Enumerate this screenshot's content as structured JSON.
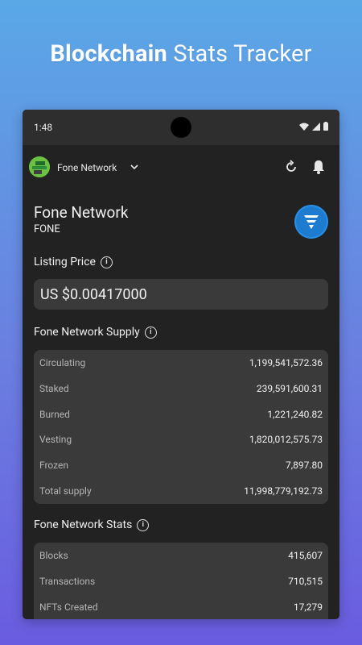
{
  "promo": {
    "title_bold": "Blockchain",
    "title_rest": "Stats Tracker"
  },
  "status_bar": {
    "time": "1:48"
  },
  "app_bar": {
    "network_selector": "Fone Network"
  },
  "coin": {
    "name": "Fone Network",
    "ticker": "FONE"
  },
  "listing_price": {
    "title": "Listing Price",
    "value": "US $0.00417000"
  },
  "supply": {
    "title": "Fone Network Supply",
    "rows": [
      {
        "label": "Circulating",
        "value": "1,199,541,572.36"
      },
      {
        "label": "Staked",
        "value": "239,591,600.31"
      },
      {
        "label": "Burned",
        "value": "1,221,240.82"
      },
      {
        "label": "Vesting",
        "value": "1,820,012,575.73"
      },
      {
        "label": "Frozen",
        "value": "7,897.80"
      },
      {
        "label": "Total supply",
        "value": "11,998,779,192.73"
      }
    ]
  },
  "stats": {
    "title": "Fone Network Stats",
    "rows": [
      {
        "label": "Blocks",
        "value": "415,607"
      },
      {
        "label": "Transactions",
        "value": "710,515"
      },
      {
        "label": "NFTs Created",
        "value": "17,279"
      }
    ]
  },
  "colors": {
    "accent_blue": "#1d7bd0",
    "card_bg": "#3a3a3a",
    "screen_bg": "#222222"
  }
}
